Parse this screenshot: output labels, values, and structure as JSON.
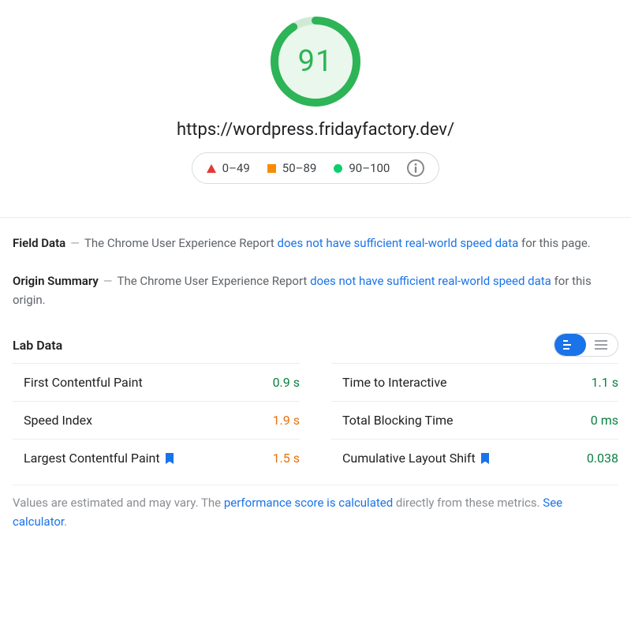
{
  "score": "91",
  "url": "https://wordpress.fridayfactory.dev/",
  "legend": {
    "low": "0–49",
    "mid": "50–89",
    "high": "90–100"
  },
  "field": {
    "title": "Field Data",
    "prefix": "The Chrome User Experience Report ",
    "link": "does not have sufficient real-world speed data",
    "suffix": " for this page."
  },
  "origin": {
    "title": "Origin Summary",
    "prefix": "The Chrome User Experience Report ",
    "link": "does not have sufficient real-world speed data",
    "suffix": " for this origin."
  },
  "lab_title": "Lab Data",
  "metrics": {
    "left": [
      {
        "name": "First Contentful Paint",
        "value": "0.9 s",
        "status": "good",
        "flag": false
      },
      {
        "name": "Speed Index",
        "value": "1.9 s",
        "status": "avg",
        "flag": false
      },
      {
        "name": "Largest Contentful Paint",
        "value": "1.5 s",
        "status": "avg",
        "flag": true
      }
    ],
    "right": [
      {
        "name": "Time to Interactive",
        "value": "1.1 s",
        "status": "good",
        "flag": false
      },
      {
        "name": "Total Blocking Time",
        "value": "0 ms",
        "status": "good",
        "flag": false
      },
      {
        "name": "Cumulative Layout Shift",
        "value": "0.038",
        "status": "good",
        "flag": true
      }
    ]
  },
  "footnote": {
    "pre": "Values are estimated and may vary. The ",
    "link1": "performance score is calculated",
    "mid": " directly from these metrics. ",
    "link2": "See calculator",
    "post": "."
  }
}
